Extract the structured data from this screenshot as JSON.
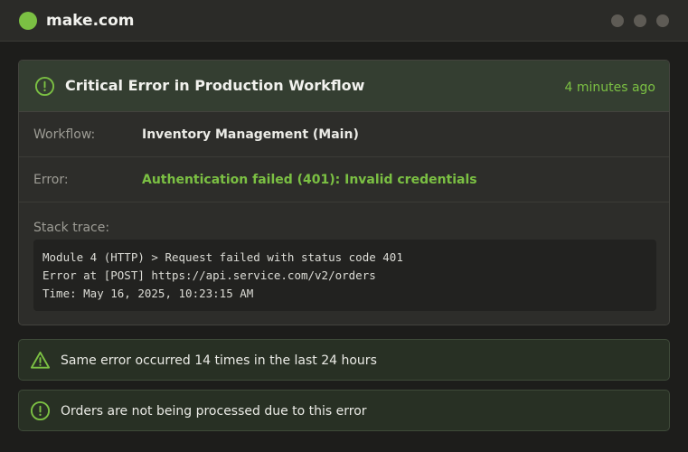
{
  "app": {
    "title": "make.com",
    "accent_color": "#7bc043",
    "window_controls": [
      "minimize",
      "maximize",
      "close"
    ]
  },
  "alert": {
    "icon": "alert-circle-icon",
    "title": "Critical Error in Production Workflow",
    "time_ago": "4 minutes ago",
    "fields": [
      {
        "label": "Workflow:",
        "value": "Inventory Management (Main)"
      },
      {
        "label": "Error:",
        "value": "Authentication failed (401): Invalid credentials"
      }
    ],
    "stack_trace": {
      "label": "Stack trace:",
      "lines": [
        "Module 4 (HTTP) > Request failed with status code 401",
        "Error at [POST] https://api.service.com/v2/orders",
        "Time: May 16, 2025, 10:23:15 AM"
      ]
    }
  },
  "notices": [
    {
      "icon": "warning-triangle-icon",
      "text": "Same error occurred 14 times in the last 24 hours"
    },
    {
      "icon": "alert-circle-icon",
      "text": "Orders are not being processed due to this error"
    }
  ]
}
